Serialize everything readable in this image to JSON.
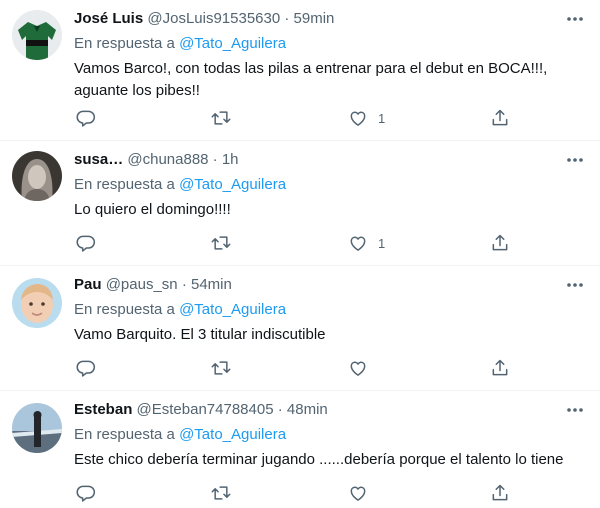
{
  "reply_prefix": "En respuesta a",
  "tweets": [
    {
      "name": "José Luis",
      "handle": "@JosLuis91535630",
      "separator": "·",
      "time": "59min",
      "mention": "@Tato_Aguilera",
      "text": "Vamos Barco!, con todas las pilas a entrenar para el debut en BOCA!!!, aguante los pibes!!",
      "likes": "1"
    },
    {
      "name": "susa…",
      "handle": "@chuna888",
      "separator": "·",
      "time": "1h",
      "mention": "@Tato_Aguilera",
      "text": "Lo quiero el domingo!!!!",
      "likes": "1"
    },
    {
      "name": "Pau",
      "handle": "@paus_sn",
      "separator": "·",
      "time": "54min",
      "mention": "@Tato_Aguilera",
      "text": "Vamo Barquito. El 3 titular indiscutible",
      "likes": ""
    },
    {
      "name": "Esteban",
      "handle": "@Esteban74788405",
      "separator": "·",
      "time": "48min",
      "mention": "@Tato_Aguilera",
      "text": "Este chico debería terminar jugando ......debería porque el talento lo tiene",
      "likes": ""
    }
  ],
  "colors": {
    "text_primary": "#0f1419",
    "text_secondary": "#536471",
    "link": "#1d9bf0",
    "divider": "#eff3f4"
  },
  "icons": [
    "more-icon",
    "reply-icon",
    "retweet-icon",
    "like-icon",
    "share-icon"
  ]
}
